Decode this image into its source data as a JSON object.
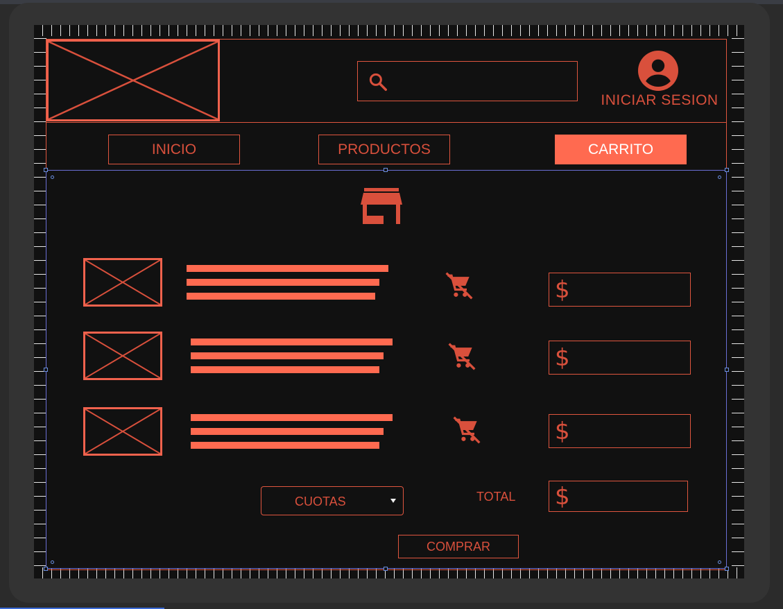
{
  "header": {
    "search_icon": "search-icon",
    "user_icon": "account-circle-icon",
    "login_label": "INICIAR SESION"
  },
  "nav": [
    {
      "label": "INICIO",
      "active": false
    },
    {
      "label": "PRODUCTOS",
      "active": false
    },
    {
      "label": "CARRITO",
      "active": true
    }
  ],
  "store_icon": "storefront-icon",
  "cart_items": [
    {
      "image": "image-placeholder",
      "remove_icon": "remove-shopping-cart-icon",
      "price_symbol": "$"
    },
    {
      "image": "image-placeholder",
      "remove_icon": "remove-shopping-cart-icon",
      "price_symbol": "$"
    },
    {
      "image": "image-placeholder",
      "remove_icon": "remove-shopping-cart-icon",
      "price_symbol": "$"
    }
  ],
  "installments_select": {
    "selected": "CUOTAS"
  },
  "total": {
    "label": "TOTAL",
    "symbol": "$"
  },
  "buy_button": {
    "label": "COMPRAR"
  },
  "colors": {
    "accent": "#ff6a50",
    "accent_dark": "#d9503c",
    "background": "#111111",
    "frame": "#333333"
  }
}
